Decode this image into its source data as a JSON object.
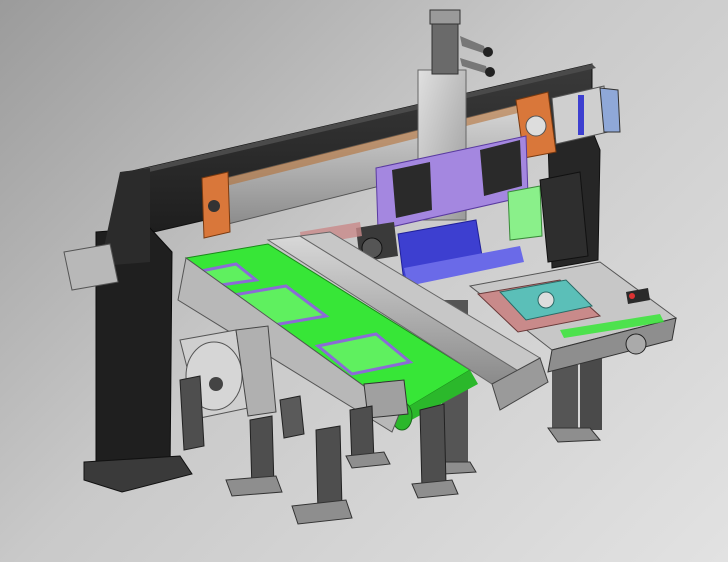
{
  "viewport": {
    "background_start": "#9b9b9b",
    "background_end": "#e2e2e2"
  },
  "model": {
    "colors": {
      "gantry_frame": "#2f2f2f",
      "frame_dark": "#1c1c1c",
      "rail_grey": "#a9a9a9",
      "orange_plate": "#d9773a",
      "purple_plate": "#a487e0",
      "blue_fixture": "#3d3fd0",
      "green_belt": "#37e637",
      "purple_trim": "#8b6bd6",
      "mint_block": "#8af08a",
      "pink_plate": "#c98a8a",
      "teal_fixture": "#5bbfb8"
    },
    "parts": [
      "gantry-beam",
      "linear-axis-module",
      "z-axis-motor",
      "x-axis-servo-motor",
      "purple-mounting-plate",
      "gripper-head",
      "green-conveyor-belt",
      "conveyor-rail",
      "support-leg",
      "workpiece-tray",
      "pallet-fixture"
    ]
  }
}
